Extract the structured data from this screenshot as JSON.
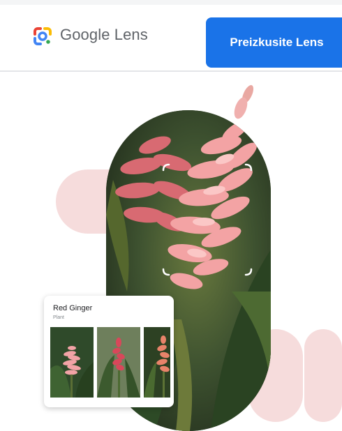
{
  "header": {
    "brand_label": "Google Lens",
    "cta_label": "Preizkusite Lens"
  },
  "result_card": {
    "title": "Red Ginger",
    "subtitle": "Plant"
  },
  "colors": {
    "primary": "#1a73e8",
    "blob": "#f6dcdc",
    "brand_text": "#5f6368"
  }
}
